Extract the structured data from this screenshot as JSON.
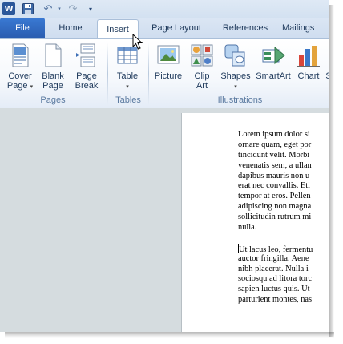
{
  "app": {
    "icon_letter": "W",
    "qat": {
      "undo_glyph": "↶",
      "redo_glyph": "↷",
      "undo_dropdown_glyph": "▾",
      "customize_glyph": "▾"
    }
  },
  "tabs": [
    {
      "label": "File"
    },
    {
      "label": "Home"
    },
    {
      "label": "Insert",
      "active": true
    },
    {
      "label": "Page Layout"
    },
    {
      "label": "References"
    },
    {
      "label": "Mailings"
    }
  ],
  "ribbon": {
    "groups": [
      {
        "label": "Pages"
      },
      {
        "label": "Tables"
      },
      {
        "label": "Illustrations"
      }
    ],
    "buttons": {
      "cover_page": {
        "line1": "Cover",
        "line2": "Page",
        "icon": "cover-page-icon"
      },
      "blank_page": {
        "line1": "Blank",
        "line2": "Page",
        "icon": "blank-page-icon"
      },
      "page_break": {
        "line1": "Page",
        "line2": "Break",
        "icon": "page-break-icon"
      },
      "table": {
        "line1": "Table",
        "icon": "table-icon"
      },
      "picture": {
        "line1": "Picture",
        "icon": "picture-icon"
      },
      "clip_art": {
        "line1": "Clip",
        "line2": "Art",
        "icon": "clip-art-icon"
      },
      "shapes": {
        "line1": "Shapes",
        "icon": "shapes-icon"
      },
      "smartart": {
        "line1": "SmartArt",
        "icon": "smartart-icon"
      },
      "chart": {
        "line1": "Chart",
        "icon": "chart-icon"
      },
      "screenshot_partial": {
        "line1": "S"
      }
    },
    "caret": "▾"
  },
  "document": {
    "paragraph1": [
      "Lorem  ipsum dolor si",
      "ornare quam,  eget por",
      "tincidunt velit.  Morbi",
      "venenatis sem, a ullan",
      "dapibus mauris non u",
      "erat nec convallis. Eti",
      "tempor at eros. Pellen",
      "adipiscing non magna",
      "sollicitudin rutrum mi",
      "nulla."
    ],
    "paragraph2": [
      "Ut lacus leo,  fermentu",
      "auctor fringilla.  Aene",
      "nibh placerat.  Nulla i",
      "sociosqu ad litora torc",
      "sapien luctus quis.  Ut",
      "parturient montes, nas"
    ]
  },
  "colors": {
    "file_tab": "#2a5caf",
    "ribbon_bg": "#f5f8fc",
    "doc_background": "#d5dcdf",
    "label_text": "#1e395b"
  }
}
